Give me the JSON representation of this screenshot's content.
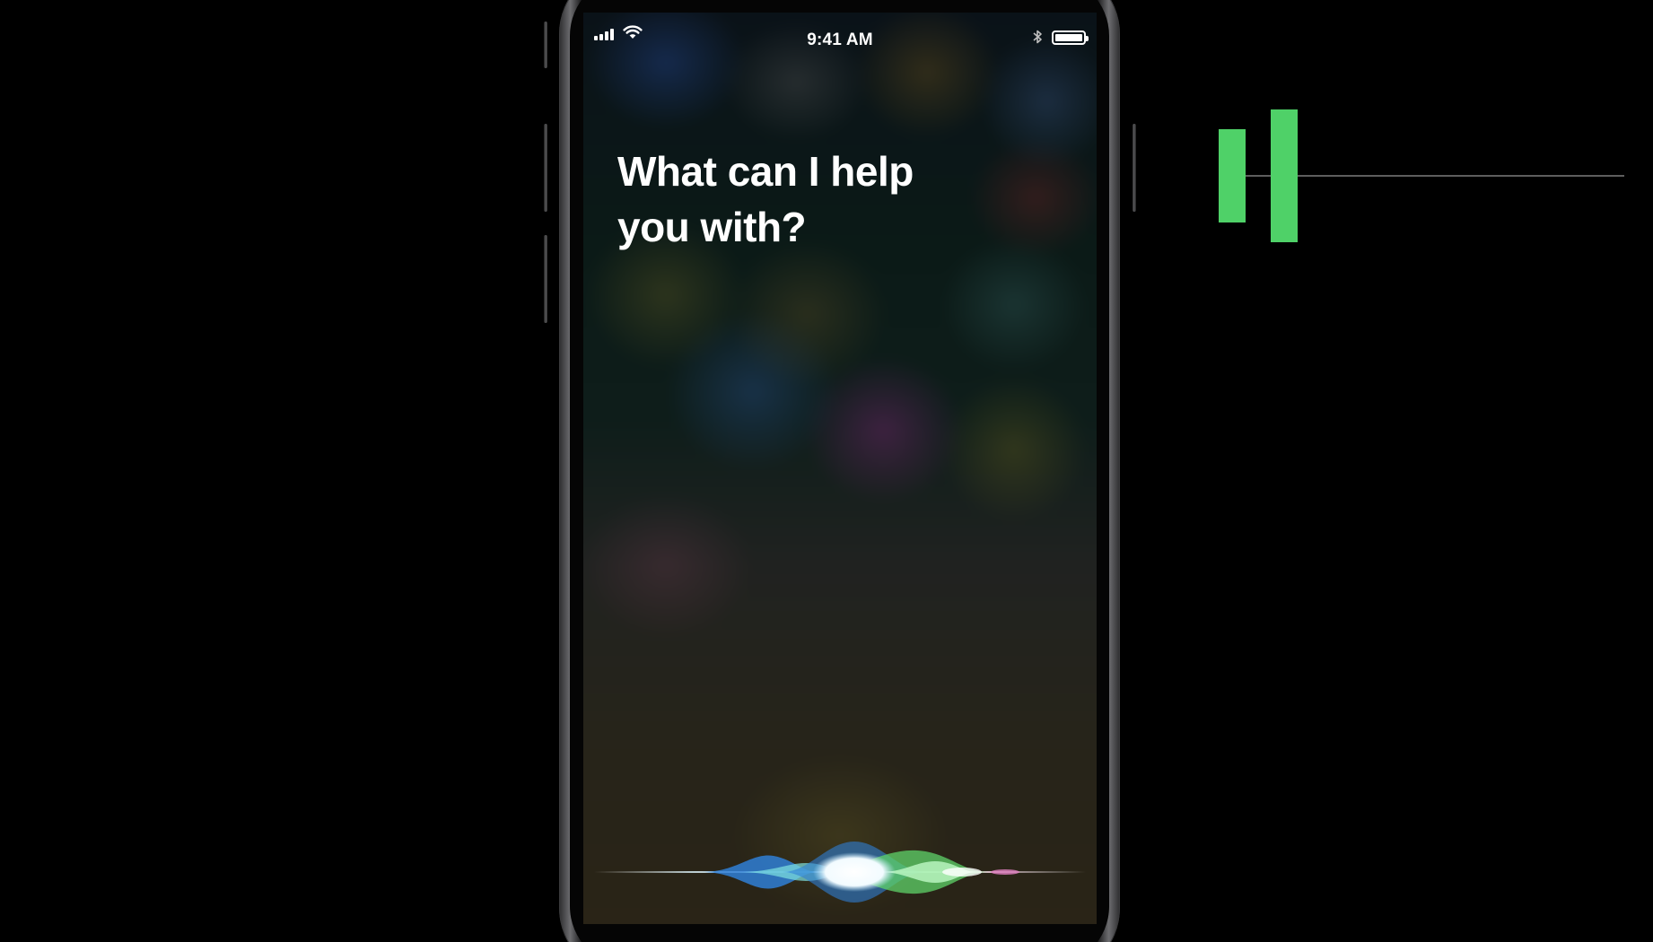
{
  "status_bar": {
    "time": "9:41 AM",
    "signal_icon": "cellular-signal-icon",
    "wifi_icon": "wifi-icon",
    "bluetooth_icon": "bluetooth-icon",
    "battery_icon": "battery-icon",
    "battery_level": 1.0
  },
  "siri": {
    "prompt": "What can I help you with?",
    "waveform_icon": "siri-waveform-icon",
    "colors": {
      "blue": "#2f7fd6",
      "green": "#5fd36a",
      "teal": "#5fd3c8",
      "pink": "#e07fc0"
    }
  },
  "audio_indicator": {
    "icon": "audio-level-bars-icon",
    "color": "#4fd168",
    "line_color": "#5e5e5e",
    "levels": [
      0.7,
      1.0
    ]
  }
}
